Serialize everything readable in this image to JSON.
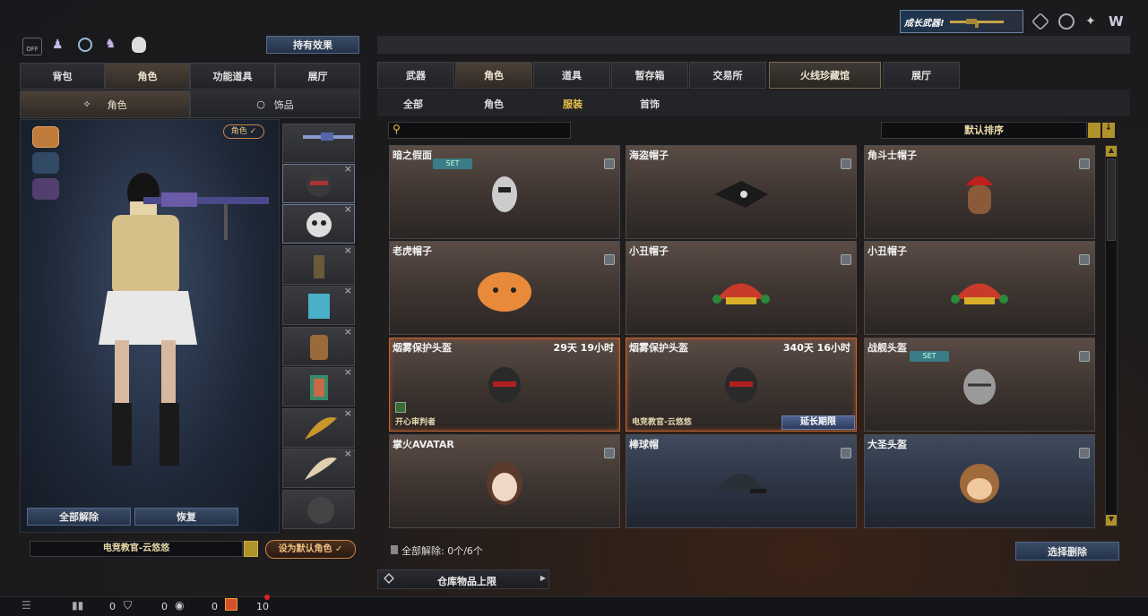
{
  "top_badge": {
    "label": "成长武器!"
  },
  "left_panel": {
    "effect_button": "持有效果",
    "toggle_label": "OFF",
    "tabs": [
      "背包",
      "角色",
      "功能道具",
      "展厅"
    ],
    "sub_tabs": [
      "角色",
      "饰品"
    ],
    "role_badge": "角色 ✓",
    "btn_unequip_all": "全部解除",
    "btn_restore": "恢复",
    "role_name": "电竞教官-云悠悠",
    "btn_set_default": "设为默认角色 ✓"
  },
  "main": {
    "tabs": [
      "武器",
      "角色",
      "道具",
      "暂存箱",
      "交易所",
      "火线珍藏馆",
      "展厅"
    ],
    "sub_tabs": [
      "全部",
      "角色",
      "服装",
      "首饰"
    ],
    "search_placeholder": "",
    "sort_label": "默认排序",
    "items": [
      {
        "name": "暗之假面",
        "set": "SET",
        "time": "",
        "owner": "",
        "extend": ""
      },
      {
        "name": "海盗帽子",
        "set": "",
        "time": "",
        "owner": "",
        "extend": ""
      },
      {
        "name": "角斗士帽子",
        "set": "",
        "time": "",
        "owner": "",
        "extend": ""
      },
      {
        "name": "老虎帽子",
        "set": "",
        "time": "",
        "owner": "",
        "extend": ""
      },
      {
        "name": "小丑帽子",
        "set": "",
        "time": "",
        "owner": "",
        "extend": ""
      },
      {
        "name": "小丑帽子",
        "set": "",
        "time": "",
        "owner": "",
        "extend": ""
      },
      {
        "name": "烟雾保护头盔",
        "set": "",
        "time": "29天 19小时",
        "owner": "开心审判者",
        "extend": ""
      },
      {
        "name": "烟雾保护头盔",
        "set": "",
        "time": "340天 16小时",
        "owner": "电竞教官-云悠悠",
        "extend": "延长期限"
      },
      {
        "name": "战舰头盔",
        "set": "SET",
        "time": "",
        "owner": "",
        "extend": ""
      },
      {
        "name": "掌火AVATAR",
        "set": "",
        "time": "",
        "owner": "",
        "extend": ""
      },
      {
        "name": "棒球帽",
        "set": "",
        "time": "",
        "owner": "",
        "extend": ""
      },
      {
        "name": "大圣头盔",
        "set": "",
        "time": "",
        "owner": "",
        "extend": ""
      }
    ],
    "unequip_status": "全部解除: 0个/6个",
    "btn_select_unequip": "选择删除",
    "warehouse_label": "仓库物品上限"
  },
  "bottom_bar": {
    "count1": "0",
    "count2": "0",
    "count3": "0",
    "count4": "10"
  },
  "colors": {
    "accent_gold": "#e8c24a",
    "selected_border": "#c26634",
    "button_blue": "#3b4c66"
  }
}
